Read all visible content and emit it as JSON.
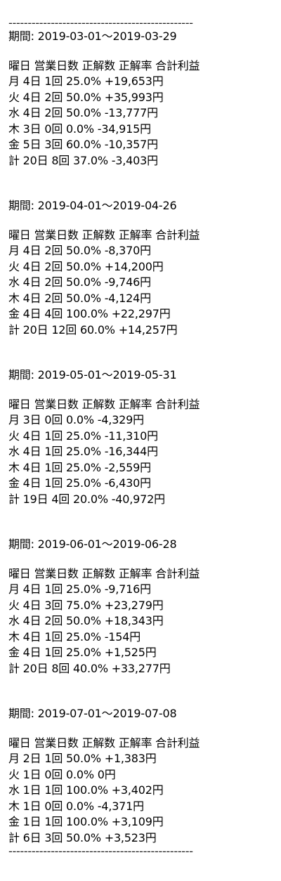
{
  "rule": "------------------------------------------------",
  "period_label": "期間:",
  "header": "曜日 営業日数 正解数 正解率 合計利益",
  "blocks": [
    {
      "period": "期間: 2019-03-01～2019-03-29",
      "rows": [
        "月 4日 1回 25.0% +19,653円",
        "火 4日 2回 50.0% +35,993円",
        "水 4日 2回 50.0% -13,777円",
        "木 3日 0回 0.0% -34,915円",
        "金 5日 3回 60.0% -10,357円",
        "計 20日 8回 37.0% -3,403円"
      ]
    },
    {
      "period": "期間: 2019-04-01～2019-04-26",
      "rows": [
        "月 4日 2回 50.0% -8,370円",
        "火 4日 2回 50.0% +14,200円",
        "水 4日 2回 50.0% -9,746円",
        "木 4日 2回 50.0% -4,124円",
        "金 4日 4回 100.0% +22,297円",
        "計 20日 12回 60.0% +14,257円"
      ]
    },
    {
      "period": "期間: 2019-05-01～2019-05-31",
      "rows": [
        "月 3日 0回 0.0% -4,329円",
        "火 4日 1回 25.0% -11,310円",
        "水 4日 1回 25.0% -16,344円",
        "木 4日 1回 25.0% -2,559円",
        "金 4日 1回 25.0% -6,430円",
        "計 19日 4回 20.0% -40,972円"
      ]
    },
    {
      "period": "期間: 2019-06-01～2019-06-28",
      "rows": [
        "月 4日 1回 25.0% -9,716円",
        "火 4日 3回 75.0% +23,279円",
        "水 4日 2回 50.0% +18,343円",
        "木 4日 1回 25.0% -154円",
        "金 4日 1回 25.0% +1,525円",
        "計 20日 8回 40.0% +33,277円"
      ]
    },
    {
      "period": "期間: 2019-07-01～2019-07-08",
      "rows": [
        "月 2日 1回 50.0% +1,383円",
        "火 1日 0回 0.0% 0円",
        "水 1日 1回 100.0% +3,402円",
        "木 1日 0回 0.0% -4,371円",
        "金 1日 1回 100.0% +3,109円",
        "計 6日 3回 50.0% +3,523円"
      ]
    }
  ]
}
